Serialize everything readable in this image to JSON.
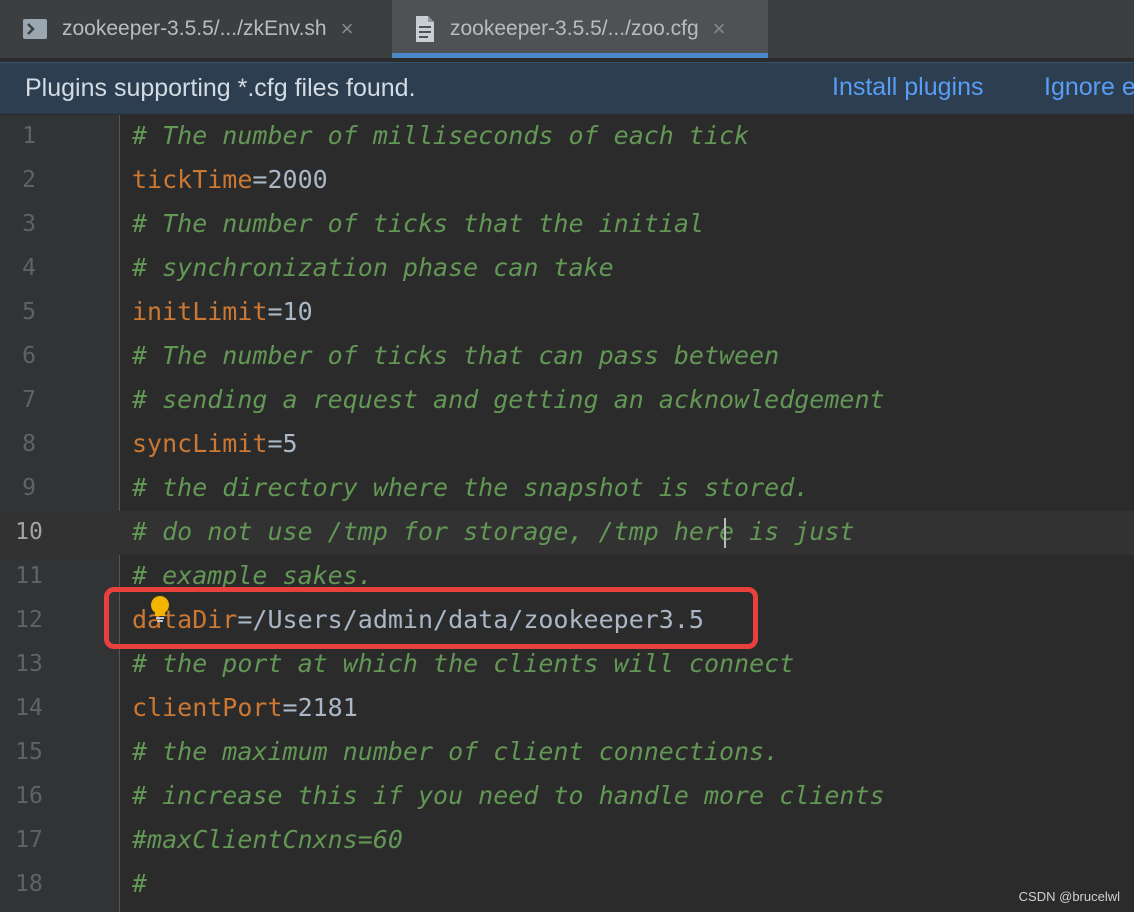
{
  "tabs": [
    {
      "label": "zookeeper-3.5.5/.../zkEnv.sh",
      "icon": "terminal-file-icon",
      "close": "×",
      "active": false
    },
    {
      "label": "zookeeper-3.5.5/.../zoo.cfg",
      "icon": "text-file-icon",
      "close": "×",
      "active": true
    }
  ],
  "banner": {
    "message": "Plugins supporting *.cfg files found.",
    "install_label": "Install plugins",
    "ignore_label": "Ignore e"
  },
  "editor": {
    "current_line": 10,
    "lines": [
      {
        "num": "1",
        "text": "# The number of milliseconds of each tick"
      },
      {
        "num": "2",
        "key": "tickTime",
        "value": "=2000"
      },
      {
        "num": "3",
        "text": "# The number of ticks that the initial"
      },
      {
        "num": "4",
        "text": "# synchronization phase can take"
      },
      {
        "num": "5",
        "key": "initLimit",
        "value": "=10"
      },
      {
        "num": "6",
        "text": "# The number of ticks that can pass between"
      },
      {
        "num": "7",
        "text": "# sending a request and getting an acknowledgement"
      },
      {
        "num": "8",
        "key": "syncLimit",
        "value": "=5"
      },
      {
        "num": "9",
        "text": "# the directory where the snapshot is stored."
      },
      {
        "num": "10",
        "text": "# do not use /tmp for storage, /tmp here is just"
      },
      {
        "num": "11",
        "text": "# example sakes."
      },
      {
        "num": "12",
        "key": "dataDir",
        "value": "=/Users/admin/data/zookeeper3.5"
      },
      {
        "num": "13",
        "text": "# the port at which the clients will connect"
      },
      {
        "num": "14",
        "key": "clientPort",
        "value": "=2181"
      },
      {
        "num": "15",
        "text": "# the maximum number of client connections."
      },
      {
        "num": "16",
        "text": "# increase this if you need to handle more clients"
      },
      {
        "num": "17",
        "text": "#maxClientCnxns=60"
      },
      {
        "num": "18",
        "text": "#"
      }
    ]
  },
  "watermark": "CSDN @brucelwl",
  "colors": {
    "comment": "#629755",
    "key": "#cc7832",
    "value": "#a9b7c6",
    "link": "#589df6",
    "highlight": "#e8403d",
    "tab_accent": "#4a88c7"
  }
}
